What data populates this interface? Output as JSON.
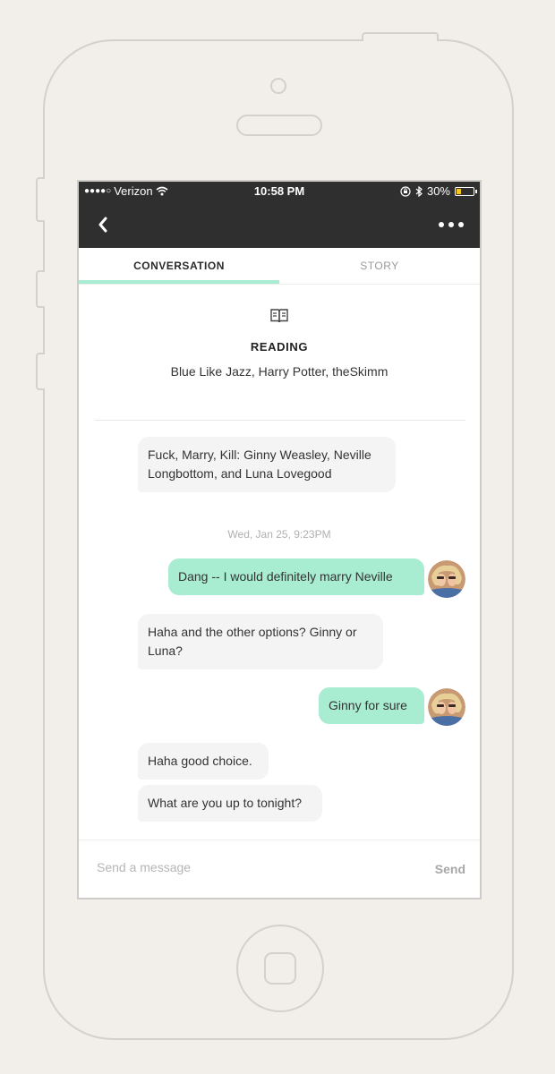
{
  "status_bar": {
    "signal": "●●●●○",
    "carrier": "Verizon",
    "time": "10:58 PM",
    "battery": "30%",
    "battery_level": 0.3
  },
  "tabs": [
    {
      "label": "CONVERSATION",
      "active": true
    },
    {
      "label": "STORY",
      "active": false
    }
  ],
  "reading": {
    "icon": "book-icon",
    "title": "READING",
    "text": "Blue Like Jazz, Harry Potter, theSkimm"
  },
  "messages": [
    {
      "from": "them",
      "text": "Fuck, Marry, Kill: Ginny Weasley, Neville Longbottom, and Luna Lovegood"
    },
    {
      "timestamp": "Wed, Jan 25, 9:23PM"
    },
    {
      "from": "me",
      "text": "Dang -- I would definitely marry Neville"
    },
    {
      "from": "them",
      "text": "Haha and the other options? Ginny or Luna?"
    },
    {
      "from": "me",
      "text": "Ginny for sure"
    },
    {
      "from": "them",
      "text": "Haha good choice."
    },
    {
      "from": "them",
      "text": "What are you up to tonight?"
    }
  ],
  "composer": {
    "placeholder": "Send a message",
    "send_label": "Send"
  },
  "colors": {
    "accent": "#a8ecd1",
    "header_bg": "#2f2f2f",
    "incoming_bubble": "#f4f4f4",
    "page_bg": "#f2eeea"
  }
}
